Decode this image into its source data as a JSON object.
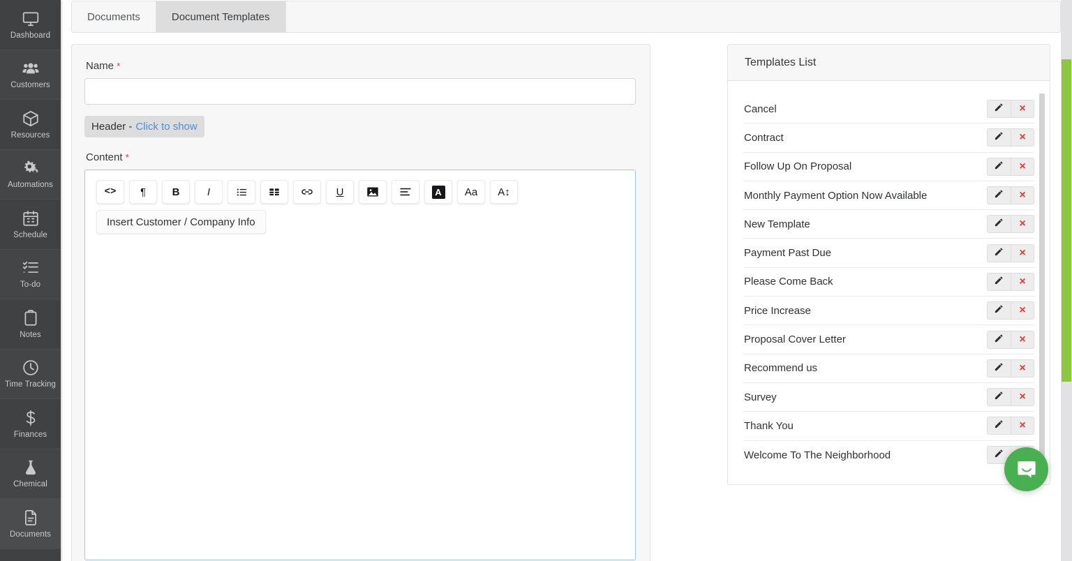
{
  "sidebar": {
    "items": [
      {
        "label": "Dashboard",
        "icon": "monitor-icon",
        "active": false
      },
      {
        "label": "Customers",
        "icon": "people-icon",
        "active": false
      },
      {
        "label": "Resources",
        "icon": "cube-icon",
        "active": false
      },
      {
        "label": "Automations",
        "icon": "gears-icon",
        "active": false
      },
      {
        "label": "Schedule",
        "icon": "calendar-icon",
        "active": false
      },
      {
        "label": "To-do",
        "icon": "checklist-icon",
        "active": false
      },
      {
        "label": "Notes",
        "icon": "clipboard-icon",
        "active": false
      },
      {
        "label": "Time Tracking",
        "icon": "clock-icon",
        "active": false
      },
      {
        "label": "Finances",
        "icon": "dollar-icon",
        "active": false
      },
      {
        "label": "Chemical",
        "icon": "flask-icon",
        "active": false
      },
      {
        "label": "Documents",
        "icon": "document-icon",
        "active": true
      }
    ]
  },
  "tabs": [
    {
      "label": "Documents",
      "active": false
    },
    {
      "label": "Document Templates",
      "active": true
    }
  ],
  "form": {
    "name_label": "Name",
    "required_mark": "*",
    "name_value": "",
    "name_placeholder": "",
    "header_prefix": "Header -",
    "header_link": "Click to show",
    "content_label": "Content",
    "insert_button": "Insert Customer / Company Info",
    "content_value": "",
    "toolbar": [
      {
        "name": "code-icon",
        "glyph": "<>"
      },
      {
        "name": "paragraph-icon",
        "glyph": "¶"
      },
      {
        "name": "bold-icon",
        "glyph": "B"
      },
      {
        "name": "italic-icon",
        "glyph": "I"
      },
      {
        "name": "bullet-list-icon",
        "glyph": "list"
      },
      {
        "name": "table-icon",
        "glyph": "table"
      },
      {
        "name": "link-icon",
        "glyph": "link"
      },
      {
        "name": "underline-icon",
        "glyph": "U"
      },
      {
        "name": "image-icon",
        "glyph": "image"
      },
      {
        "name": "align-icon",
        "glyph": "align"
      },
      {
        "name": "text-background-color-icon",
        "glyph": "A"
      },
      {
        "name": "font-family-icon",
        "glyph": "Aa"
      },
      {
        "name": "font-size-icon",
        "glyph": "A↕"
      }
    ]
  },
  "templates_panel": {
    "title": "Templates List",
    "edit_icon": "pencil-icon",
    "delete_icon": "x-icon",
    "delete_glyph": "×",
    "items": [
      {
        "name": "Cancel"
      },
      {
        "name": "Contract"
      },
      {
        "name": "Follow Up On Proposal"
      },
      {
        "name": "Monthly Payment Option Now Available"
      },
      {
        "name": "New Template"
      },
      {
        "name": "Payment Past Due"
      },
      {
        "name": "Please Come Back"
      },
      {
        "name": "Price Increase"
      },
      {
        "name": "Proposal Cover Letter"
      },
      {
        "name": "Recommend us"
      },
      {
        "name": "Survey"
      },
      {
        "name": "Thank You"
      },
      {
        "name": "Welcome To The Neighborhood"
      }
    ]
  },
  "chat_widget": {
    "icon": "intercom-chat-icon"
  },
  "colors": {
    "sidebar_bg": "#3f4142",
    "accent_green": "#8fc63f",
    "link_blue": "#4a90d9",
    "danger_red": "#e53935",
    "chat_green": "#48b051",
    "focus_border": "#9fc6e8"
  }
}
